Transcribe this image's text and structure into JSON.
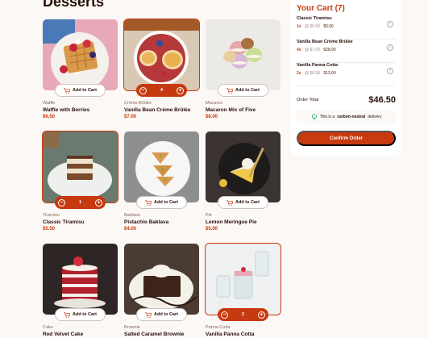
{
  "page": {
    "title": "Desserts"
  },
  "products": [
    {
      "category": "Waffle",
      "name": "Waffle with Berries",
      "price": "$6.50",
      "add_label": "Add to Cart",
      "in_cart": false,
      "quantity": null
    },
    {
      "category": "Crème Brûlée",
      "name": "Vanilla Bean Crème Brûlée",
      "price": "$7.00",
      "add_label": "Add to Cart",
      "in_cart": true,
      "quantity": "4"
    },
    {
      "category": "Macaron",
      "name": "Macaron Mix of Five",
      "price": "$8.00",
      "add_label": "Add to Cart",
      "in_cart": false,
      "quantity": null
    },
    {
      "category": "Tiramisu",
      "name": "Classic Tiramisu",
      "price": "$5.50",
      "add_label": "Add to Cart",
      "in_cart": true,
      "quantity": "1"
    },
    {
      "category": "Baklava",
      "name": "Pistachio Baklava",
      "price": "$4.00",
      "add_label": "Add to Cart",
      "in_cart": false,
      "quantity": null
    },
    {
      "category": "Pie",
      "name": "Lemon Meringue Pie",
      "price": "$5.00",
      "add_label": "Add to Cart",
      "in_cart": false,
      "quantity": null
    },
    {
      "category": "Cake",
      "name": "Red Velvet Cake",
      "price": "",
      "add_label": "Add to Cart",
      "in_cart": false,
      "quantity": null
    },
    {
      "category": "Brownie",
      "name": "Salted Caramel Brownie",
      "price": "",
      "add_label": "Add to Cart",
      "in_cart": false,
      "quantity": null
    },
    {
      "category": "Panna Cotta",
      "name": "Vanilla Panna Cotta",
      "price": "",
      "add_label": "Add to Cart",
      "in_cart": true,
      "quantity": "2"
    }
  ],
  "cart": {
    "title": "Your Cart (7)",
    "items": [
      {
        "name": "Classic Tiramisu",
        "qty": "1x",
        "unit": "@ $5.50",
        "total": "$5.50"
      },
      {
        "name": "Vanilla Bean Crème Brûlée",
        "qty": "4x",
        "unit": "@ $7.00",
        "total": "$28.00"
      },
      {
        "name": "Vanilla Panna Cotta",
        "qty": "2x",
        "unit": "@ $6.50",
        "total": "$13.00"
      }
    ],
    "order_total_label": "Order Total",
    "order_total": "$46.50",
    "carbon_prefix": "This is a",
    "carbon_bold": "carbon-neutral",
    "carbon_suffix": "delivery",
    "confirm_label": "Confirm Order"
  },
  "colors": {
    "accent": "#c73a0f",
    "text": "#260f08",
    "muted": "#87635a",
    "background": "#fcf8f5",
    "card": "#ffffff"
  }
}
